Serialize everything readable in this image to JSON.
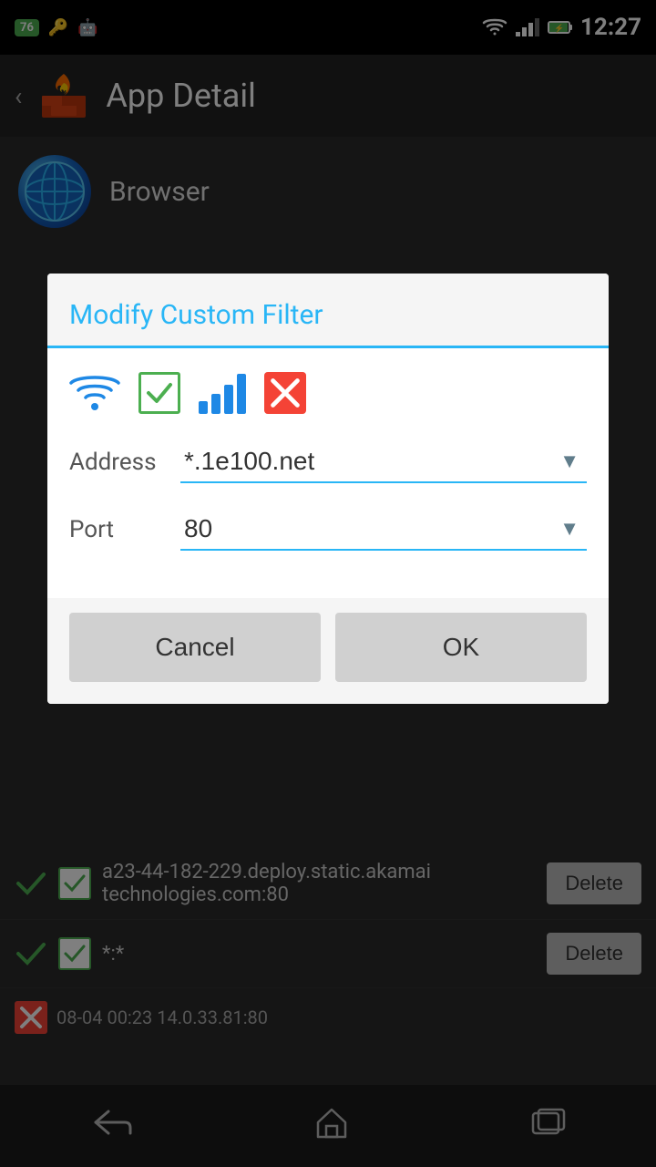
{
  "statusBar": {
    "time": "12:27",
    "badge": "76"
  },
  "topBar": {
    "title": "App Detail",
    "backLabel": "‹"
  },
  "appInfo": {
    "name": "Browser"
  },
  "dialog": {
    "title": "Modify Custom Filter",
    "addressLabel": "Address",
    "addressValue": "*.1e100.net",
    "portLabel": "Port",
    "portValue": "80",
    "cancelLabel": "Cancel",
    "okLabel": "OK"
  },
  "listRows": [
    {
      "text": "a23-44-182-229.deploy.static.akamai\ntechnologies.com:80",
      "deleteLabel": "Delete"
    },
    {
      "text": "*:*",
      "deleteLabel": "Delete"
    }
  ],
  "timestampRow": {
    "text": "08-04 00:23  14.0.33.81:80"
  },
  "bottomNav": {
    "backLabel": "⟵",
    "homeLabel": "⌂",
    "recentLabel": "▭"
  }
}
